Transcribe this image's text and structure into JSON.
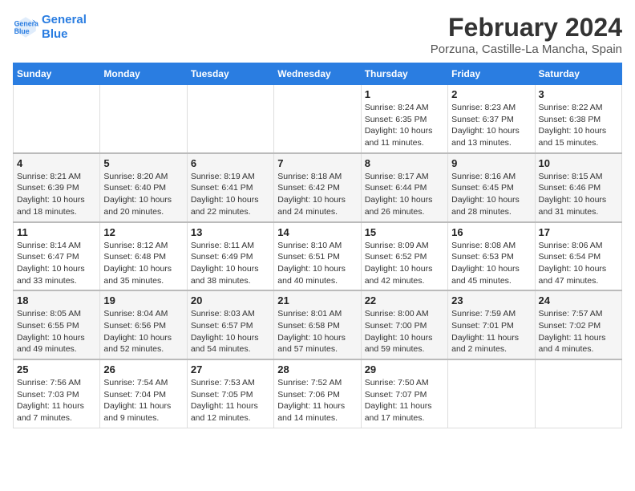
{
  "header": {
    "logo_line1": "General",
    "logo_line2": "Blue",
    "title": "February 2024",
    "subtitle": "Porzuna, Castille-La Mancha, Spain"
  },
  "days_of_week": [
    "Sunday",
    "Monday",
    "Tuesday",
    "Wednesday",
    "Thursday",
    "Friday",
    "Saturday"
  ],
  "weeks": [
    [
      {
        "day": "",
        "info": ""
      },
      {
        "day": "",
        "info": ""
      },
      {
        "day": "",
        "info": ""
      },
      {
        "day": "",
        "info": ""
      },
      {
        "day": "1",
        "info": "Sunrise: 8:24 AM\nSunset: 6:35 PM\nDaylight: 10 hours\nand 11 minutes."
      },
      {
        "day": "2",
        "info": "Sunrise: 8:23 AM\nSunset: 6:37 PM\nDaylight: 10 hours\nand 13 minutes."
      },
      {
        "day": "3",
        "info": "Sunrise: 8:22 AM\nSunset: 6:38 PM\nDaylight: 10 hours\nand 15 minutes."
      }
    ],
    [
      {
        "day": "4",
        "info": "Sunrise: 8:21 AM\nSunset: 6:39 PM\nDaylight: 10 hours\nand 18 minutes."
      },
      {
        "day": "5",
        "info": "Sunrise: 8:20 AM\nSunset: 6:40 PM\nDaylight: 10 hours\nand 20 minutes."
      },
      {
        "day": "6",
        "info": "Sunrise: 8:19 AM\nSunset: 6:41 PM\nDaylight: 10 hours\nand 22 minutes."
      },
      {
        "day": "7",
        "info": "Sunrise: 8:18 AM\nSunset: 6:42 PM\nDaylight: 10 hours\nand 24 minutes."
      },
      {
        "day": "8",
        "info": "Sunrise: 8:17 AM\nSunset: 6:44 PM\nDaylight: 10 hours\nand 26 minutes."
      },
      {
        "day": "9",
        "info": "Sunrise: 8:16 AM\nSunset: 6:45 PM\nDaylight: 10 hours\nand 28 minutes."
      },
      {
        "day": "10",
        "info": "Sunrise: 8:15 AM\nSunset: 6:46 PM\nDaylight: 10 hours\nand 31 minutes."
      }
    ],
    [
      {
        "day": "11",
        "info": "Sunrise: 8:14 AM\nSunset: 6:47 PM\nDaylight: 10 hours\nand 33 minutes."
      },
      {
        "day": "12",
        "info": "Sunrise: 8:12 AM\nSunset: 6:48 PM\nDaylight: 10 hours\nand 35 minutes."
      },
      {
        "day": "13",
        "info": "Sunrise: 8:11 AM\nSunset: 6:49 PM\nDaylight: 10 hours\nand 38 minutes."
      },
      {
        "day": "14",
        "info": "Sunrise: 8:10 AM\nSunset: 6:51 PM\nDaylight: 10 hours\nand 40 minutes."
      },
      {
        "day": "15",
        "info": "Sunrise: 8:09 AM\nSunset: 6:52 PM\nDaylight: 10 hours\nand 42 minutes."
      },
      {
        "day": "16",
        "info": "Sunrise: 8:08 AM\nSunset: 6:53 PM\nDaylight: 10 hours\nand 45 minutes."
      },
      {
        "day": "17",
        "info": "Sunrise: 8:06 AM\nSunset: 6:54 PM\nDaylight: 10 hours\nand 47 minutes."
      }
    ],
    [
      {
        "day": "18",
        "info": "Sunrise: 8:05 AM\nSunset: 6:55 PM\nDaylight: 10 hours\nand 49 minutes."
      },
      {
        "day": "19",
        "info": "Sunrise: 8:04 AM\nSunset: 6:56 PM\nDaylight: 10 hours\nand 52 minutes."
      },
      {
        "day": "20",
        "info": "Sunrise: 8:03 AM\nSunset: 6:57 PM\nDaylight: 10 hours\nand 54 minutes."
      },
      {
        "day": "21",
        "info": "Sunrise: 8:01 AM\nSunset: 6:58 PM\nDaylight: 10 hours\nand 57 minutes."
      },
      {
        "day": "22",
        "info": "Sunrise: 8:00 AM\nSunset: 7:00 PM\nDaylight: 10 hours\nand 59 minutes."
      },
      {
        "day": "23",
        "info": "Sunrise: 7:59 AM\nSunset: 7:01 PM\nDaylight: 11 hours\nand 2 minutes."
      },
      {
        "day": "24",
        "info": "Sunrise: 7:57 AM\nSunset: 7:02 PM\nDaylight: 11 hours\nand 4 minutes."
      }
    ],
    [
      {
        "day": "25",
        "info": "Sunrise: 7:56 AM\nSunset: 7:03 PM\nDaylight: 11 hours\nand 7 minutes."
      },
      {
        "day": "26",
        "info": "Sunrise: 7:54 AM\nSunset: 7:04 PM\nDaylight: 11 hours\nand 9 minutes."
      },
      {
        "day": "27",
        "info": "Sunrise: 7:53 AM\nSunset: 7:05 PM\nDaylight: 11 hours\nand 12 minutes."
      },
      {
        "day": "28",
        "info": "Sunrise: 7:52 AM\nSunset: 7:06 PM\nDaylight: 11 hours\nand 14 minutes."
      },
      {
        "day": "29",
        "info": "Sunrise: 7:50 AM\nSunset: 7:07 PM\nDaylight: 11 hours\nand 17 minutes."
      },
      {
        "day": "",
        "info": ""
      },
      {
        "day": "",
        "info": ""
      }
    ]
  ]
}
